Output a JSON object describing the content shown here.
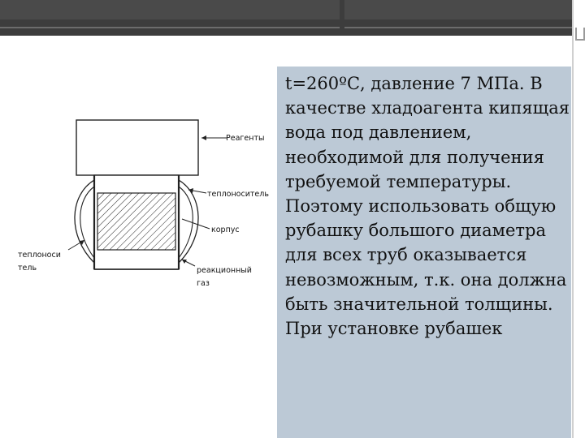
{
  "slide": {
    "body_text": "t=260ºС, давление 7 МПа. В качестве хладоагента кипящая вода под давлением, необходимой для получения требуемой температуры. Поэтому использовать общую рубашку большого диаметра для всех труб оказывается невозможным, т.к. она должна быть значительной толщины. При установке рубашек",
    "diagram_labels": {
      "reagents": "Реагенты",
      "coolant": "теплоноситель",
      "body": "корпус",
      "reaction_gas_1": "реакционный",
      "reaction_gas_2": "газ",
      "coolant_left_1": "теплоноси",
      "coolant_left_2": "тель"
    }
  }
}
